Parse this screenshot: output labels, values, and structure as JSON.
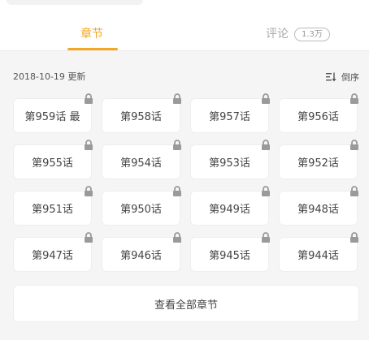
{
  "tabs": {
    "chapters_label": "章节",
    "comments_label": "评论",
    "comments_count": "1.3万",
    "active_color": "#f5a623"
  },
  "update": {
    "text": "2018-10-19 更新"
  },
  "sort": {
    "label": "倒序",
    "icon": "sort-descending-icon"
  },
  "chapters": [
    {
      "label": "第959话 最",
      "locked": true
    },
    {
      "label": "第958话",
      "locked": true
    },
    {
      "label": "第957话",
      "locked": true
    },
    {
      "label": "第956话",
      "locked": true
    },
    {
      "label": "第955话",
      "locked": true
    },
    {
      "label": "第954话",
      "locked": true
    },
    {
      "label": "第953话",
      "locked": true
    },
    {
      "label": "第952话",
      "locked": true
    },
    {
      "label": "第951话",
      "locked": true
    },
    {
      "label": "第950话",
      "locked": true
    },
    {
      "label": "第949话",
      "locked": true
    },
    {
      "label": "第948话",
      "locked": true
    },
    {
      "label": "第947话",
      "locked": true
    },
    {
      "label": "第946话",
      "locked": true
    },
    {
      "label": "第945话",
      "locked": true
    },
    {
      "label": "第944话",
      "locked": true
    }
  ],
  "view_all": {
    "label": "查看全部章节"
  }
}
